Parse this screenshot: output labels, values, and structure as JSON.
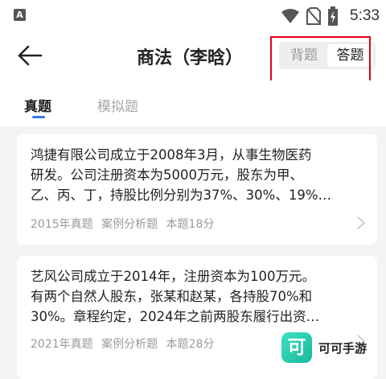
{
  "status_bar": {
    "app_badge": "A",
    "time": "5:33",
    "icons": [
      "wifi-icon",
      "no-sim-icon",
      "battery-charging-icon"
    ]
  },
  "header": {
    "title": "商法（李晗）",
    "mode_toggle": [
      {
        "label": "背题",
        "selected": false
      },
      {
        "label": "答题",
        "selected": true
      }
    ],
    "highlight_color": "#e0001b"
  },
  "tabs": [
    {
      "label": "真题",
      "active": true
    },
    {
      "label": "模拟题",
      "active": false
    }
  ],
  "accent_color": "#2f7cf6",
  "questions": [
    {
      "lines": [
        "鸿捷有限公司成立于2008年3月，从事生物医药",
        "研发。公司注册资本为5000万元，股东为甲、",
        "乙、丙、丁，持股比例分别为37%、30%、19%…"
      ],
      "year": "2015年真题",
      "type": "案例分析题",
      "score": "本题18分"
    },
    {
      "lines": [
        "艺风公司成立于2014年，注册资本为100万元。",
        "有两个自然人股东，张某和赵某，各持股70%和",
        "30%。章程约定，2024年之前两股东履行出资…"
      ],
      "year": "2021年真题",
      "type": "案例分析题",
      "score": "本题28分"
    }
  ],
  "watermark": {
    "logo_char": "可",
    "text": "可可手游"
  }
}
